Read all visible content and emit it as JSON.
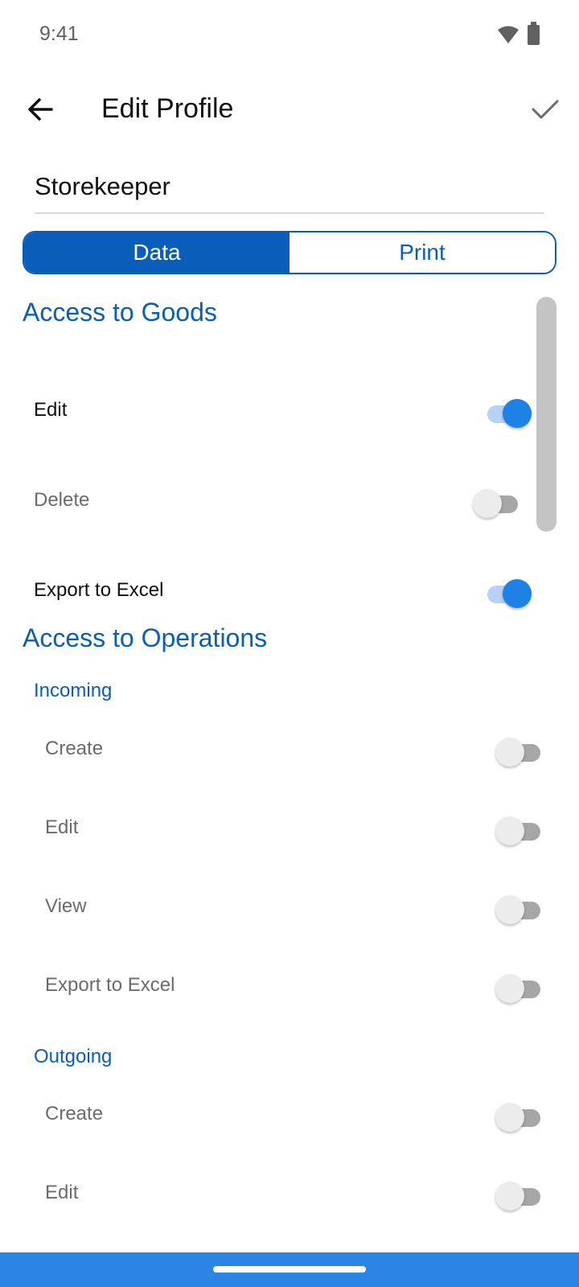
{
  "status_bar": {
    "time": "9:41"
  },
  "header": {
    "title": "Edit Profile"
  },
  "profile": {
    "name": "Storekeeper"
  },
  "tabs": [
    {
      "label": "Data",
      "active": true
    },
    {
      "label": "Print",
      "active": false
    }
  ],
  "goods": {
    "title": "Access to Goods",
    "items": [
      {
        "label": "Edit",
        "on": true
      },
      {
        "label": "Delete",
        "on": false
      },
      {
        "label": "Export to Excel",
        "on": true
      }
    ]
  },
  "operations": {
    "title": "Access to Operations",
    "incoming": {
      "title": "Incoming",
      "items": [
        {
          "label": "Create",
          "on": false
        },
        {
          "label": "Edit",
          "on": false
        },
        {
          "label": "View",
          "on": false
        },
        {
          "label": "Export to Excel",
          "on": false
        }
      ]
    },
    "outgoing": {
      "title": "Outgoing",
      "items": [
        {
          "label": "Create",
          "on": false
        },
        {
          "label": "Edit",
          "on": false
        }
      ]
    }
  },
  "icons": {
    "back": "arrow-left-icon",
    "confirm": "check-icon",
    "wifi": "wifi-icon",
    "battery": "battery-icon"
  },
  "colors": {
    "accent": "#0a5db8",
    "switch_on": "#1e81e4",
    "nav_bar": "#2c85e5"
  }
}
